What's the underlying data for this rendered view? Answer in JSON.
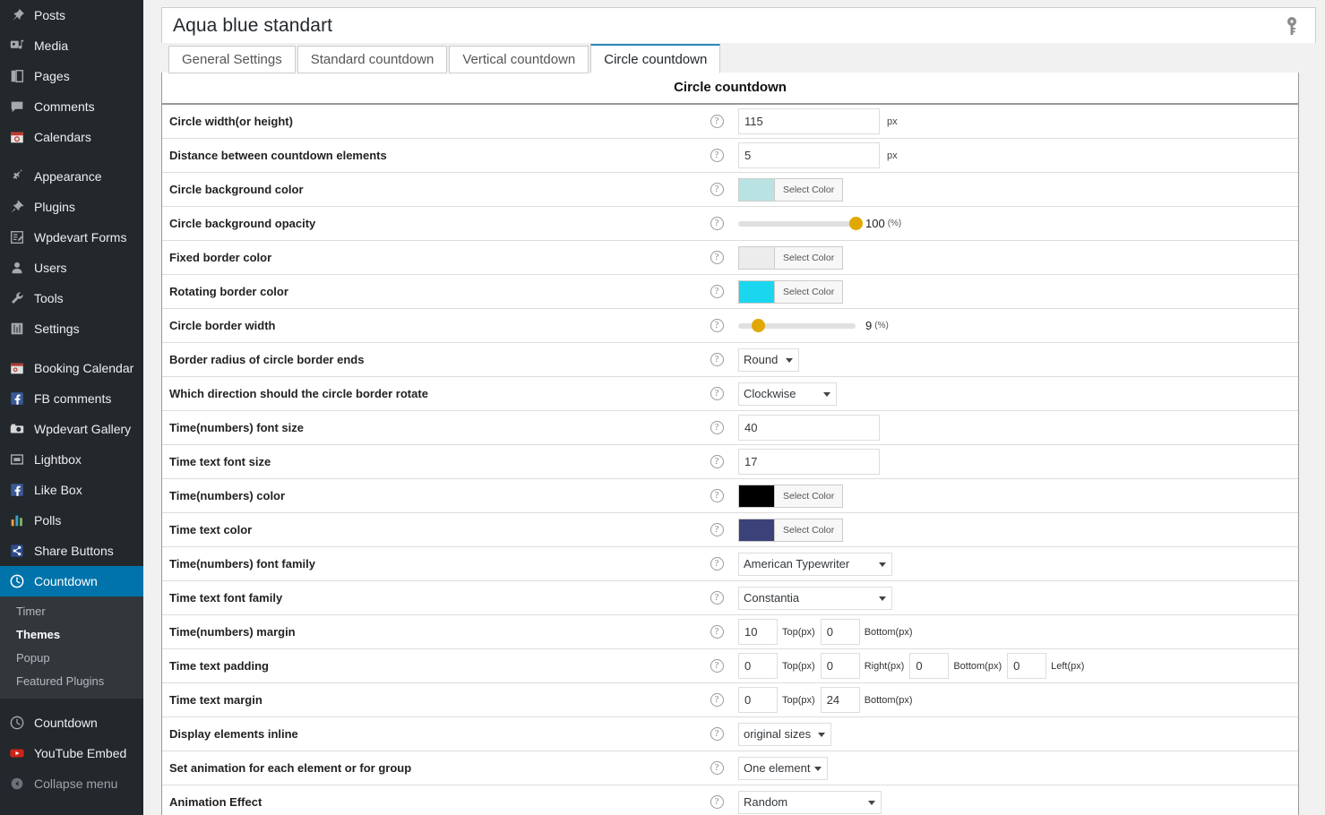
{
  "sidebar": {
    "items": [
      {
        "label": "Posts",
        "icon": "pin-icon",
        "state": "normal"
      },
      {
        "label": "Media",
        "icon": "media-icon",
        "state": "normal"
      },
      {
        "label": "Pages",
        "icon": "pages-icon",
        "state": "normal"
      },
      {
        "label": "Comments",
        "icon": "comments-icon",
        "state": "normal"
      },
      {
        "label": "Calendars",
        "icon": "calendar-icon",
        "state": "normal"
      },
      {
        "label": "Appearance",
        "icon": "brush-icon",
        "state": "normal",
        "gap": true
      },
      {
        "label": "Plugins",
        "icon": "plug-icon",
        "state": "normal"
      },
      {
        "label": "Wpdevart Forms",
        "icon": "form-icon",
        "state": "normal"
      },
      {
        "label": "Users",
        "icon": "user-icon",
        "state": "normal"
      },
      {
        "label": "Tools",
        "icon": "wrench-icon",
        "state": "normal"
      },
      {
        "label": "Settings",
        "icon": "sliders-icon",
        "state": "normal"
      },
      {
        "label": "Booking Calendar",
        "icon": "booking-calendar-icon",
        "state": "normal",
        "gap": true
      },
      {
        "label": "FB comments",
        "icon": "facebook-icon",
        "state": "normal"
      },
      {
        "label": "Wpdevart Gallery",
        "icon": "camera-icon",
        "state": "normal"
      },
      {
        "label": "Lightbox",
        "icon": "lightbox-icon",
        "state": "normal"
      },
      {
        "label": "Like Box",
        "icon": "facebook-icon",
        "state": "normal"
      },
      {
        "label": "Polls",
        "icon": "bar-chart-icon",
        "state": "normal"
      },
      {
        "label": "Share Buttons",
        "icon": "share-icon",
        "state": "normal"
      },
      {
        "label": "Countdown",
        "icon": "clock-icon",
        "state": "active"
      }
    ],
    "submenu": [
      {
        "label": "Timer",
        "current": false
      },
      {
        "label": "Themes",
        "current": true
      },
      {
        "label": "Popup",
        "current": false
      },
      {
        "label": "Featured Plugins",
        "current": false
      }
    ],
    "tail_items": [
      {
        "label": "Countdown",
        "icon": "clock-outline-icon",
        "state": "normal"
      },
      {
        "label": "YouTube Embed",
        "icon": "youtube-icon",
        "state": "normal"
      },
      {
        "label": "Collapse menu",
        "icon": "collapse-icon",
        "state": "dim"
      }
    ],
    "accent_color": "#0073aa",
    "bg_color": "#23282d",
    "submenu_bg_color": "#32373c"
  },
  "header": {
    "title": "Aqua blue standart",
    "key_icon": "key-icon"
  },
  "tabs": [
    {
      "label": "General Settings",
      "active": false
    },
    {
      "label": "Standard countdown",
      "active": false
    },
    {
      "label": "Vertical countdown",
      "active": false
    },
    {
      "label": "Circle countdown",
      "active": true
    }
  ],
  "section": {
    "heading": "Circle countdown",
    "help_glyph": "?"
  },
  "labels": {
    "px": "px",
    "percent": "(%)",
    "select_color": "Select Color",
    "top_px": "Top(px)",
    "bottom_px": "Bottom(px)",
    "right_px": "Right(px)",
    "left_px": "Left(px)"
  },
  "rows": {
    "circle_width": {
      "label": "Circle width(or height)",
      "value": "115"
    },
    "distance": {
      "label": "Distance between countdown elements",
      "value": "5"
    },
    "circle_bg_color": {
      "label": "Circle background color",
      "color": "#b9e3e3"
    },
    "circle_bg_opacity": {
      "label": "Circle background opacity",
      "value": "100",
      "percent": 100
    },
    "fixed_border_color": {
      "label": "Fixed border color",
      "color": "#ececec"
    },
    "rotating_border_color": {
      "label": "Rotating border color",
      "color": "#1ad6ef"
    },
    "circle_border_width": {
      "label": "Circle border width",
      "value": "9",
      "percent": 9
    },
    "border_radius_ends": {
      "label": "Border radius of circle border ends",
      "value": "Round"
    },
    "rotate_direction": {
      "label": "Which direction should the circle border rotate",
      "value": "Clockwise"
    },
    "numbers_font_size": {
      "label": "Time(numbers) font size",
      "value": "40"
    },
    "text_font_size": {
      "label": "Time text font size",
      "value": "17"
    },
    "numbers_color": {
      "label": "Time(numbers) color",
      "color": "#000000"
    },
    "text_color": {
      "label": "Time text color",
      "color": "#3b4279"
    },
    "numbers_font_family": {
      "label": "Time(numbers) font family",
      "value": "American Typewriter"
    },
    "text_font_family": {
      "label": "Time text font family",
      "value": "Constantia"
    },
    "numbers_margin": {
      "label": "Time(numbers) margin",
      "top": "10",
      "bottom": "0"
    },
    "text_padding": {
      "label": "Time text padding",
      "top": "0",
      "right": "0",
      "bottom": "0",
      "left": "0"
    },
    "text_margin": {
      "label": "Time text margin",
      "top": "0",
      "bottom": "24"
    },
    "display_inline": {
      "label": "Display elements inline",
      "value": "original sizes"
    },
    "animation_scope": {
      "label": "Set animation for each element or for group",
      "value": "One element"
    },
    "animation_effect": {
      "label": "Animation Effect",
      "value": "Random"
    }
  }
}
